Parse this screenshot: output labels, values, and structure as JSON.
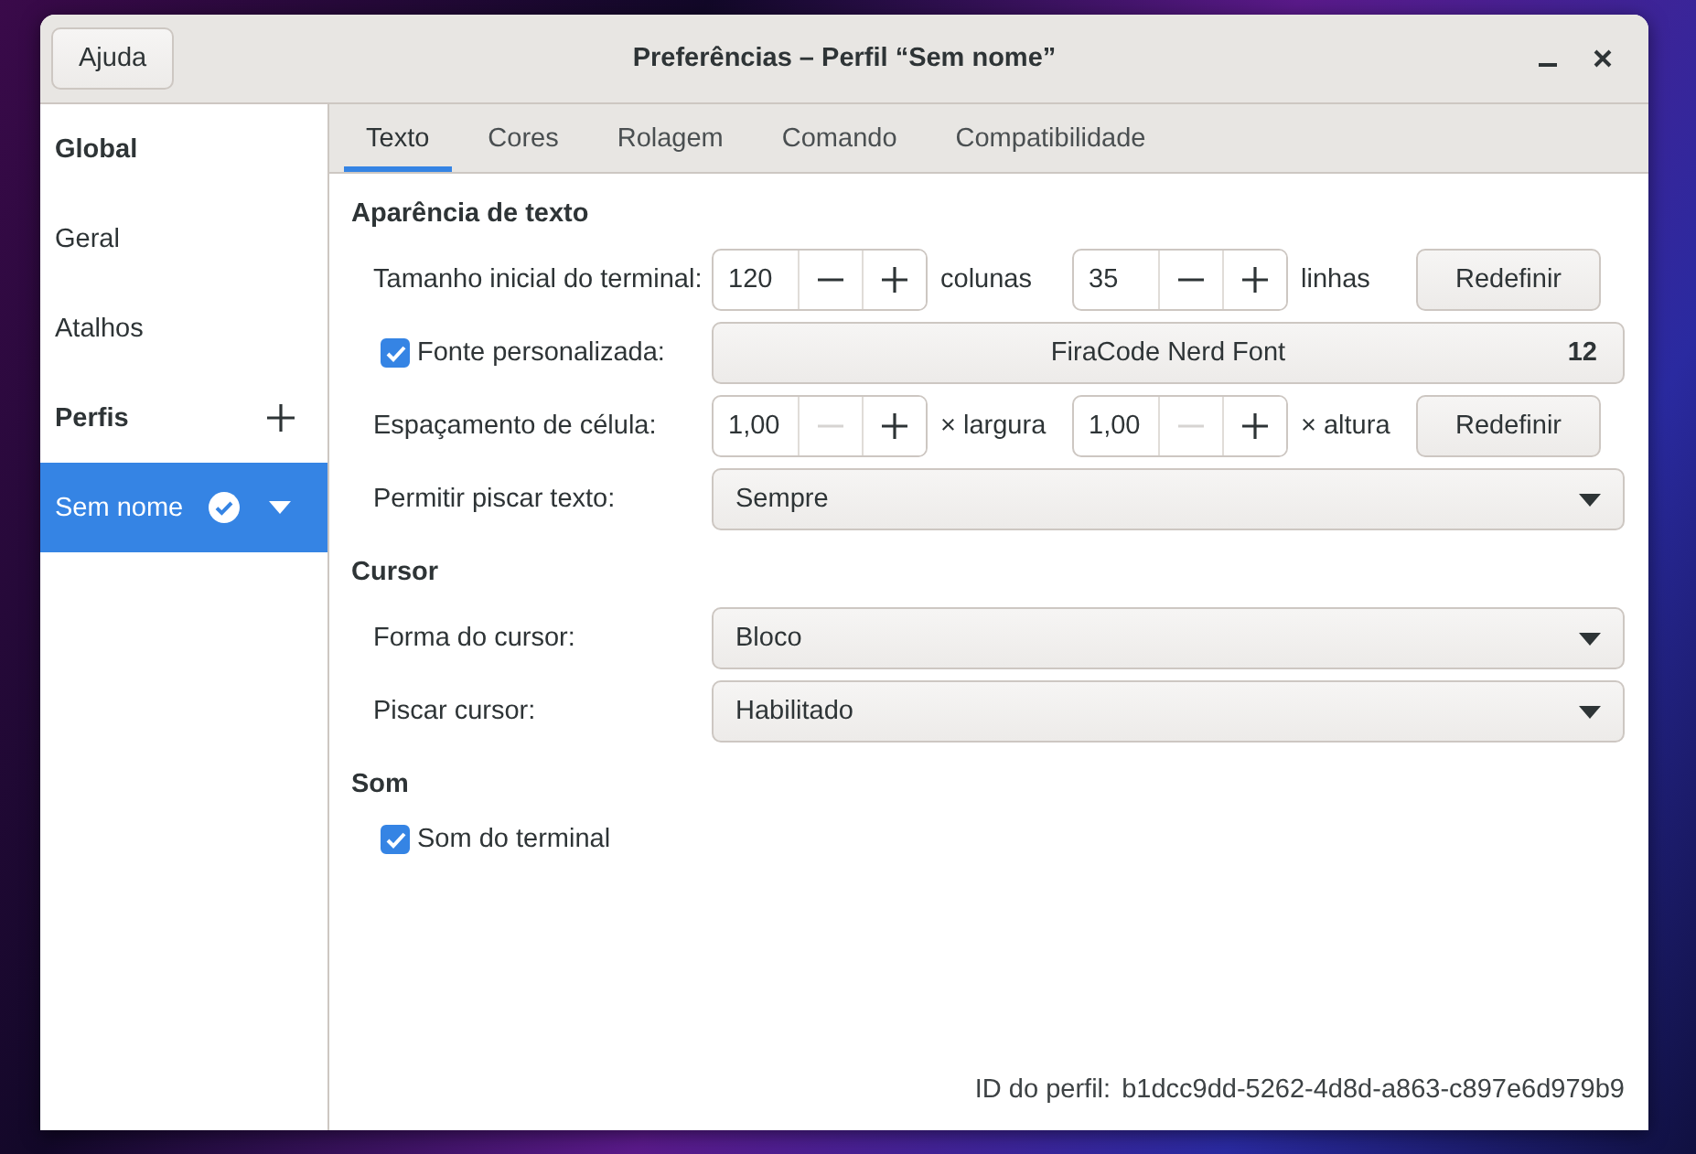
{
  "window": {
    "title": "Preferências – Perfil “Sem nome”",
    "help_button": "Ajuda"
  },
  "sidebar": {
    "items": [
      {
        "kind": "heading",
        "label": "Global"
      },
      {
        "kind": "item",
        "label": "Geral",
        "selected": false
      },
      {
        "kind": "item",
        "label": "Atalhos",
        "selected": false
      },
      {
        "kind": "heading_add",
        "label": "Perfis"
      },
      {
        "kind": "profile",
        "label": "Sem nome",
        "selected": true,
        "default": true
      }
    ]
  },
  "tabs": [
    {
      "label": "Texto",
      "selected": true
    },
    {
      "label": "Cores",
      "selected": false
    },
    {
      "label": "Rolagem",
      "selected": false
    },
    {
      "label": "Comando",
      "selected": false
    },
    {
      "label": "Compatibilidade",
      "selected": false
    }
  ],
  "sections": [
    {
      "title": "Aparência de texto",
      "rows": [
        {
          "kind": "spin_pair",
          "label": "Tamanho inicial do terminal:",
          "spins": [
            {
              "value": "120",
              "unit": "colunas",
              "decrement_disabled": false
            },
            {
              "value": "35",
              "unit": "linhas",
              "decrement_disabled": false
            }
          ],
          "button": "Redefinir"
        },
        {
          "kind": "font",
          "label": "Fonte personalizada:",
          "checked": true,
          "font": "FiraCode Nerd Font",
          "size": "12"
        },
        {
          "kind": "spin_pair",
          "label": "Espaçamento de célula:",
          "spins": [
            {
              "value": "1,00",
              "unit": "× largura",
              "decrement_disabled": true
            },
            {
              "value": "1,00",
              "unit": "× altura",
              "decrement_disabled": true
            }
          ],
          "button": "Redefinir"
        },
        {
          "kind": "dropdown",
          "label": "Permitir piscar texto:",
          "value": "Sempre"
        }
      ]
    },
    {
      "title": "Cursor",
      "rows": [
        {
          "kind": "dropdown",
          "label": "Forma do cursor:",
          "value": "Bloco"
        },
        {
          "kind": "dropdown",
          "label": "Piscar cursor:",
          "value": "Habilitado"
        }
      ]
    },
    {
      "title": "Som",
      "rows": [
        {
          "kind": "checkbox",
          "label": "Som do terminal",
          "checked": true
        }
      ]
    }
  ],
  "profile_id": {
    "label": "ID do perfil:",
    "value": "b1dcc9dd-5262-4d8d-a863-c897e6d979b9"
  }
}
